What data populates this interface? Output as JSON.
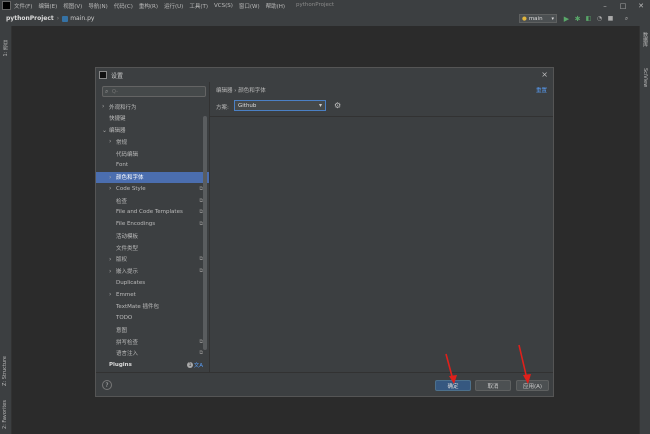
{
  "menu": {
    "items": [
      "文件(F)",
      "编辑(E)",
      "视图(V)",
      "导航(N)",
      "代码(C)",
      "重构(R)",
      "运行(U)",
      "工具(T)",
      "VCS(S)",
      "窗口(W)",
      "帮助(H)"
    ],
    "project_title": "pythonProject"
  },
  "nav": {
    "project": "pythonProject",
    "file": "main.py",
    "run_config": "main"
  },
  "left_strip": {
    "project_tab": "1: 项目",
    "structure_tab": "Z: Structure",
    "favorites_tab": "2: Favorites"
  },
  "right_strip": {
    "database_tab": "数据库",
    "sciview_tab": "SciView"
  },
  "dialog": {
    "title": "设置",
    "search_placeholder": "Q-",
    "tree": [
      {
        "label": "外观和行为",
        "arrow": "›",
        "indent": 0
      },
      {
        "label": "快捷键",
        "arrow": "",
        "indent": 0
      },
      {
        "label": "编辑器",
        "arrow": "⌄",
        "indent": 0
      },
      {
        "label": "常规",
        "arrow": "›",
        "indent": 1
      },
      {
        "label": "代码编辑",
        "arrow": "",
        "indent": 1
      },
      {
        "label": "Font",
        "arrow": "",
        "indent": 1
      },
      {
        "label": "颜色和字体",
        "arrow": "›",
        "indent": 1,
        "selected": true
      },
      {
        "label": "Code Style",
        "arrow": "›",
        "indent": 1,
        "copy": true
      },
      {
        "label": "检查",
        "arrow": "",
        "indent": 1,
        "copy": true
      },
      {
        "label": "File and Code Templates",
        "arrow": "",
        "indent": 1,
        "copy": true
      },
      {
        "label": "File Encodings",
        "arrow": "",
        "indent": 1,
        "copy": true
      },
      {
        "label": "活动模板",
        "arrow": "",
        "indent": 1
      },
      {
        "label": "文件类型",
        "arrow": "",
        "indent": 1
      },
      {
        "label": "版权",
        "arrow": "›",
        "indent": 1,
        "copy": true
      },
      {
        "label": "嵌入提示",
        "arrow": "›",
        "indent": 1,
        "copy": true
      },
      {
        "label": "Duplicates",
        "arrow": "",
        "indent": 1
      },
      {
        "label": "Emmet",
        "arrow": "›",
        "indent": 1
      },
      {
        "label": "TextMate 插件包",
        "arrow": "",
        "indent": 1
      },
      {
        "label": "TODO",
        "arrow": "",
        "indent": 1
      },
      {
        "label": "意图",
        "arrow": "",
        "indent": 1
      },
      {
        "label": "拼写检查",
        "arrow": "",
        "indent": 1,
        "copy": true
      },
      {
        "label": "语言注入",
        "arrow": "",
        "indent": 1,
        "copy": true
      },
      {
        "label": "Plugins",
        "arrow": "",
        "indent": 0,
        "bold": true,
        "badges": true
      }
    ],
    "breadcrumb": "编辑器  ›  颜色和字体",
    "reset_link": "重置",
    "scheme_label": "方案:",
    "scheme_value": "Github",
    "ok_label": "确定",
    "cancel_label": "取消",
    "apply_label": "应用(A)",
    "help_label": "?"
  },
  "colors": {
    "accent": "#4b6eaf",
    "annotation_arrow": "#e0201b",
    "run_green": "#59a869"
  }
}
